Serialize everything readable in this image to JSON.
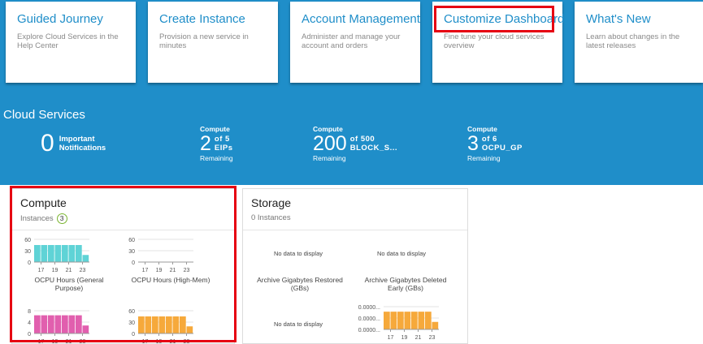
{
  "nav_cards": [
    {
      "title": "Guided Journey",
      "desc": "Explore Cloud Services in the Help Center"
    },
    {
      "title": "Create Instance",
      "desc": "Provision a new service in minutes"
    },
    {
      "title": "Account Management",
      "desc": "Administer and manage your account and orders"
    },
    {
      "title": "Customize Dashboard",
      "desc": "Fine tune your cloud services overview"
    },
    {
      "title": "What's New",
      "desc": "Learn about changes in the latest releases"
    }
  ],
  "cloud_services": {
    "title": "Cloud Services",
    "notifications": {
      "count": "0",
      "label_line1": "Important",
      "label_line2": "Notifications"
    },
    "metrics": [
      {
        "category": "Compute",
        "value": "2",
        "of_line1": "of 5",
        "of_line2": "EIPs",
        "sub": "Remaining"
      },
      {
        "category": "Compute",
        "value": "200",
        "of_line1": "of 500",
        "of_line2": "BLOCK_S...",
        "sub": "Remaining"
      },
      {
        "category": "Compute",
        "value": "3",
        "of_line1": "of 6",
        "of_line2": "OCPU_GP",
        "sub": "Remaining"
      }
    ]
  },
  "compute_panel": {
    "title": "Compute",
    "subtitle": "Instances",
    "count": "3"
  },
  "storage_panel": {
    "title": "Storage",
    "subtitle": "0 Instances",
    "no_data": "No data to display",
    "chart_caption_1": "Archive Gigabytes Restored (GBs)",
    "chart_caption_2": "Archive Gigabytes Deleted Early (GBs)"
  },
  "chart_data": [
    {
      "type": "bar",
      "caption": "OCPU Hours (General Purpose)",
      "color": "#5fd3d6",
      "yticks": [
        "60",
        "30",
        "0"
      ],
      "ylim": [
        0,
        80
      ],
      "xticks": [
        "17",
        "19",
        "21",
        "23"
      ],
      "values": [
        60,
        60,
        60,
        60,
        60,
        60,
        60,
        25
      ]
    },
    {
      "type": "bar",
      "caption": "OCPU Hours (High-Mem)",
      "color": "#5fd3d6",
      "yticks": [
        "60",
        "30",
        "0"
      ],
      "ylim": [
        0,
        80
      ],
      "xticks": [
        "17",
        "19",
        "21",
        "23"
      ],
      "values": [
        0,
        0,
        0,
        0,
        0,
        0,
        0,
        0
      ]
    },
    {
      "type": "bar",
      "caption": "",
      "color": "#e15fae",
      "yticks": [
        "8",
        "4",
        "0"
      ],
      "ylim": [
        0,
        10
      ],
      "xticks": [
        "17",
        "19",
        "21",
        "23"
      ],
      "values": [
        8,
        8,
        8,
        8,
        8,
        8,
        8,
        3.5
      ]
    },
    {
      "type": "bar",
      "caption": "",
      "color": "#f6a93b",
      "yticks": [
        "60",
        "30",
        "0"
      ],
      "ylim": [
        0,
        80
      ],
      "xticks": [
        "17",
        "19",
        "21",
        "23"
      ],
      "values": [
        60,
        60,
        60,
        60,
        60,
        60,
        60,
        25
      ]
    },
    {
      "type": "bar",
      "caption": "",
      "color": "#f6a93b",
      "yticks": [
        "0.0000...",
        "0.0000...",
        "0.0000..."
      ],
      "ylim": [
        0,
        1
      ],
      "xticks": [
        "17",
        "19",
        "21",
        "23"
      ],
      "values": [
        0.78,
        0.78,
        0.78,
        0.78,
        0.78,
        0.78,
        0.78,
        0.33
      ]
    }
  ]
}
